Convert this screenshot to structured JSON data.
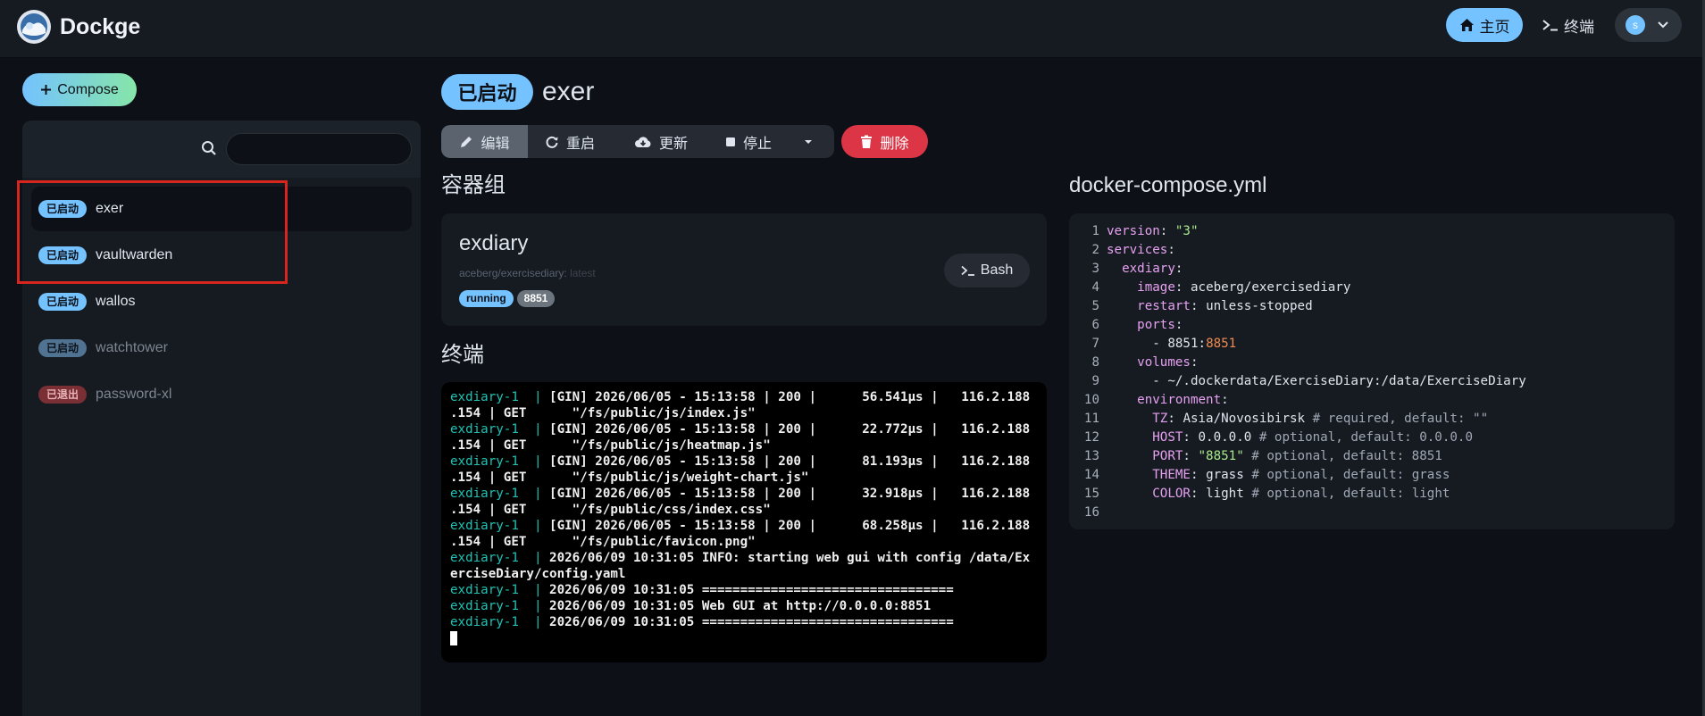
{
  "header": {
    "brand": "Dockge",
    "nav_home": "主页",
    "nav_terminal": "终端",
    "avatar_letter": "s"
  },
  "sidebar": {
    "compose_label": "Compose",
    "search_value": "",
    "stacks": [
      {
        "status": "已启动",
        "name": "exer",
        "status_color": "#74c2ff",
        "active": true
      },
      {
        "status": "已启动",
        "name": "vaultwarden",
        "status_color": "#74c2ff",
        "active": false
      },
      {
        "status": "已启动",
        "name": "wallos",
        "status_color": "#74c2ff",
        "active": false
      },
      {
        "status": "已启动",
        "name": "watchtower",
        "status_color": "#4f7391",
        "active": false
      },
      {
        "status": "已退出",
        "name": "password-xl",
        "status_color": "#7a2f35",
        "active": false
      }
    ]
  },
  "main": {
    "status": "已启动",
    "stack_name": "exer",
    "actions": {
      "edit": "编辑",
      "restart": "重启",
      "update": "更新",
      "stop": "停止",
      "delete": "删除"
    },
    "containers_title": "容器组",
    "container": {
      "name": "exdiary",
      "image": "aceberg/exercisediary:",
      "tag": "latest",
      "state": "running",
      "port": "8851",
      "bash_label": "Bash"
    },
    "terminal_title": "终端",
    "terminal_lines": [
      {
        "prefix": "exdiary-1  | ",
        "text": "[GIN] 2026/06/05 - 15:13:58 | 200 |      56.541µs |   116.2.188"
      },
      {
        "prefix": "",
        "text": ".154 | GET      \"/fs/public/js/index.js\""
      },
      {
        "prefix": "exdiary-1  | ",
        "text": "[GIN] 2026/06/05 - 15:13:58 | 200 |      22.772µs |   116.2.188"
      },
      {
        "prefix": "",
        "text": ".154 | GET      \"/fs/public/js/heatmap.js\""
      },
      {
        "prefix": "exdiary-1  | ",
        "text": "[GIN] 2026/06/05 - 15:13:58 | 200 |      81.193µs |   116.2.188"
      },
      {
        "prefix": "",
        "text": ".154 | GET      \"/fs/public/js/weight-chart.js\""
      },
      {
        "prefix": "exdiary-1  | ",
        "text": "[GIN] 2026/06/05 - 15:13:58 | 200 |      32.918µs |   116.2.188"
      },
      {
        "prefix": "",
        "text": ".154 | GET      \"/fs/public/css/index.css\""
      },
      {
        "prefix": "exdiary-1  | ",
        "text": "[GIN] 2026/06/05 - 15:13:58 | 200 |      68.258µs |   116.2.188"
      },
      {
        "prefix": "",
        "text": ".154 | GET      \"/fs/public/favicon.png\""
      },
      {
        "prefix": "exdiary-1  | ",
        "text": "2026/06/09 10:31:05 INFO: starting web gui with config /data/Ex"
      },
      {
        "prefix": "",
        "text": "erciseDiary/config.yaml"
      },
      {
        "prefix": "exdiary-1  | ",
        "text": "2026/06/09 10:31:05 ================================="
      },
      {
        "prefix": "exdiary-1  | ",
        "text": "2026/06/09 10:31:05 Web GUI at http://0.0.0.0:8851"
      },
      {
        "prefix": "exdiary-1  | ",
        "text": "2026/06/09 10:31:05 ================================="
      }
    ],
    "yaml_title": "docker-compose.yml",
    "yaml_lines": [
      {
        "n": "1",
        "indent": "",
        "key": "version",
        "sep": ": ",
        "val": "\"3\"",
        "vcls": "s",
        "comment": ""
      },
      {
        "n": "2",
        "indent": "",
        "key": "services",
        "sep": ":",
        "val": "",
        "vcls": "",
        "comment": ""
      },
      {
        "n": "3",
        "indent": "  ",
        "key": "exdiary",
        "sep": ":",
        "val": "",
        "vcls": "",
        "comment": ""
      },
      {
        "n": "4",
        "indent": "    ",
        "key": "image",
        "sep": ": ",
        "val": "aceberg/exercisediary",
        "vcls": "",
        "comment": ""
      },
      {
        "n": "5",
        "indent": "    ",
        "key": "restart",
        "sep": ": ",
        "val": "unless-stopped",
        "vcls": "",
        "comment": ""
      },
      {
        "n": "6",
        "indent": "    ",
        "key": "ports",
        "sep": ":",
        "val": "",
        "vcls": "",
        "comment": ""
      },
      {
        "n": "7",
        "indent": "      - ",
        "key": "",
        "sep": "",
        "val": "8851:",
        "vcls": "",
        "val2": "8851",
        "comment": ""
      },
      {
        "n": "8",
        "indent": "    ",
        "key": "volumes",
        "sep": ":",
        "val": "",
        "vcls": "",
        "comment": ""
      },
      {
        "n": "9",
        "indent": "      - ",
        "key": "",
        "sep": "",
        "val": "~/.dockerdata/ExerciseDiary:/data/ExerciseDiary",
        "vcls": "",
        "comment": ""
      },
      {
        "n": "10",
        "indent": "    ",
        "key": "environment",
        "sep": ":",
        "val": "",
        "vcls": "",
        "comment": ""
      },
      {
        "n": "11",
        "indent": "      ",
        "key": "TZ",
        "sep": ": ",
        "val": "Asia/Novosibirsk",
        "vcls": "",
        "comment": " # required, default: \"\""
      },
      {
        "n": "12",
        "indent": "      ",
        "key": "HOST",
        "sep": ": ",
        "val": "0.0.0.0",
        "vcls": "",
        "comment": " # optional, default: 0.0.0.0"
      },
      {
        "n": "13",
        "indent": "      ",
        "key": "PORT",
        "sep": ": ",
        "val": "\"8851\"",
        "vcls": "s",
        "comment": " # optional, default: 8851"
      },
      {
        "n": "14",
        "indent": "      ",
        "key": "THEME",
        "sep": ": ",
        "val": "grass",
        "vcls": "",
        "comment": " # optional, default: grass"
      },
      {
        "n": "15",
        "indent": "      ",
        "key": "COLOR",
        "sep": ": ",
        "val": "light",
        "vcls": "",
        "comment": " # optional, default: light"
      },
      {
        "n": "16",
        "indent": "",
        "key": "",
        "sep": "",
        "val": "",
        "vcls": "",
        "comment": ""
      }
    ]
  },
  "colors": {
    "accent": "#74c2ff",
    "danger": "#dc3545",
    "highlight": "#d7261e"
  }
}
